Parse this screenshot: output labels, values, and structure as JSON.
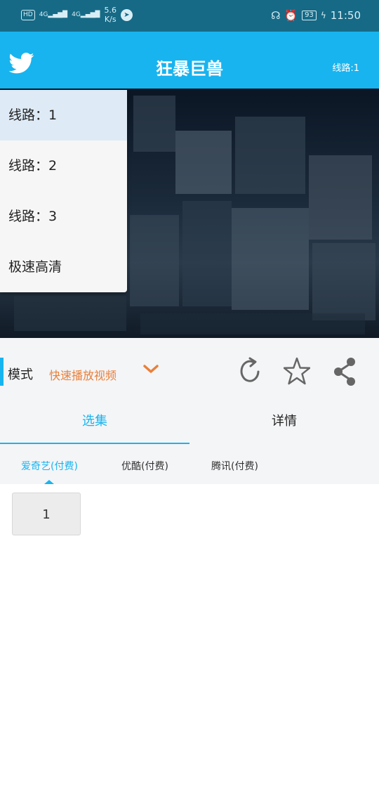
{
  "status_bar": {
    "network_1": "4G",
    "network_2": "4G",
    "speed": "5.6",
    "speed_unit": "K/s",
    "battery": "93",
    "time": "11:50",
    "icons": [
      "hd-icon",
      "signal-icon",
      "data-saver-icon",
      "headphone-icon",
      "alarm-icon",
      "battery-icon",
      "charging-icon"
    ]
  },
  "header": {
    "title": "狂暴巨兽",
    "line_label": "线路:1",
    "brand_color": "#18b4ef"
  },
  "line_menu": {
    "items": [
      "线路：1",
      "线路：2",
      "线路：3",
      "极速高清"
    ],
    "selected_index": 0
  },
  "mode": {
    "label": "模式",
    "value": "快速播放视频",
    "accent_color": "#e8803a"
  },
  "actions": [
    "refresh-icon",
    "star-icon",
    "share-icon"
  ],
  "tabs": [
    {
      "label": "选集",
      "active": true
    },
    {
      "label": "详情",
      "active": false
    }
  ],
  "sources": [
    {
      "label": "爱奇艺(付费)",
      "active": true
    },
    {
      "label": "优酷(付费)",
      "active": false
    },
    {
      "label": "腾讯(付费)",
      "active": false
    }
  ],
  "episodes": [
    "1"
  ]
}
